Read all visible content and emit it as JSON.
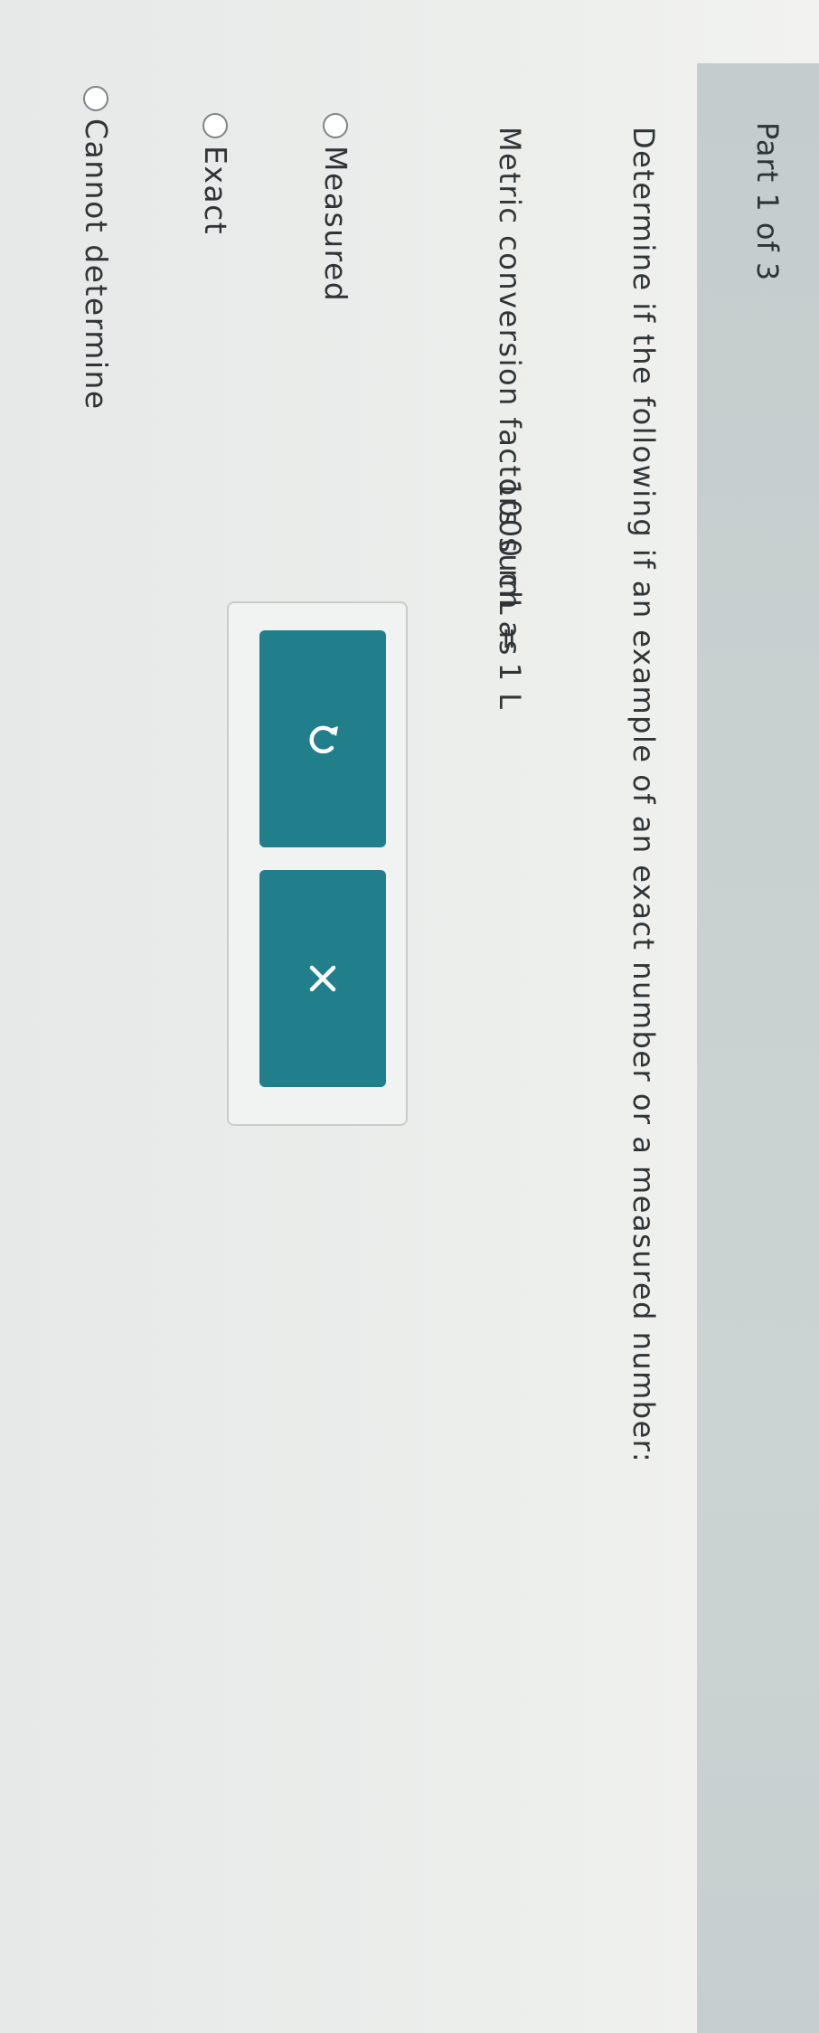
{
  "header": {
    "part_label": "Part 1 of 3"
  },
  "question": {
    "instruction": "Determine if the following if an example of an exact number or a measured number:",
    "prompt_text": "Metric conversion factors such as",
    "prompt_equation": "1000 mL = 1 L"
  },
  "options": [
    {
      "label": "Measured"
    },
    {
      "label": "Exact"
    },
    {
      "label": "Cannot determine"
    }
  ],
  "actions": {
    "reset_icon": "undo-icon",
    "clear_icon": "close-icon",
    "button_color": "#217f8c"
  }
}
